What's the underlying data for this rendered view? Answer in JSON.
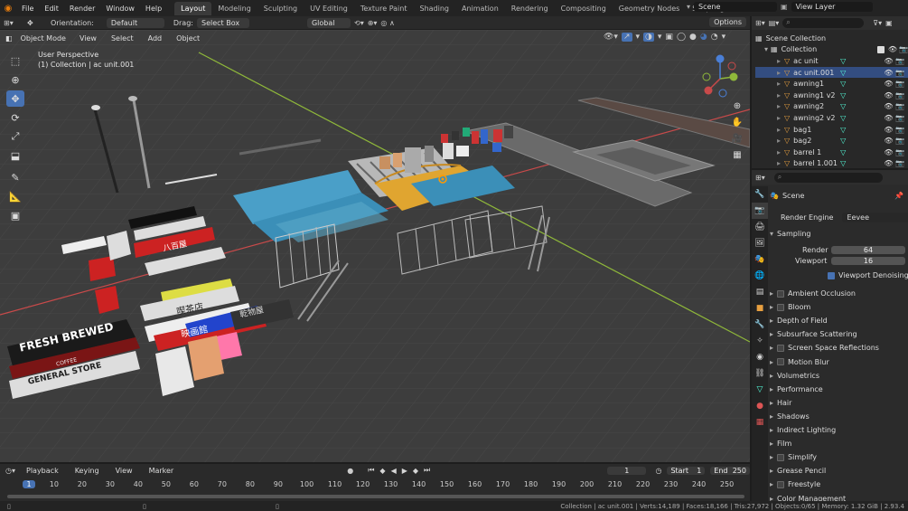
{
  "menubar": {
    "items": [
      "File",
      "Edit",
      "Render",
      "Window",
      "Help"
    ],
    "workspaces": [
      "Layout",
      "Modeling",
      "Sculpting",
      "UV Editing",
      "Texture Paint",
      "Shading",
      "Animation",
      "Rendering",
      "Compositing",
      "Geometry Nodes",
      "Scripting"
    ],
    "active_workspace": "Layout",
    "scene": "Scene",
    "view_layer": "View Layer"
  },
  "tool_header": {
    "orientation_label": "Orientation:",
    "orientation_value": "Default",
    "drag_label": "Drag:",
    "drag_value": "Select Box",
    "transform_value": "Global",
    "options": "Options"
  },
  "viewport_header": {
    "mode": "Object Mode",
    "menus": [
      "View",
      "Select",
      "Add",
      "Object"
    ]
  },
  "viewport": {
    "perspective": "User Perspective",
    "collection_info": "(1) Collection | ac unit.001",
    "signs": [
      "FRESH BREWED",
      "COFFEE",
      "GENERAL STORE",
      "八百屋",
      "喫茶店",
      "映画館",
      "乾物屋"
    ]
  },
  "outliner": {
    "root": "Scene Collection",
    "collection": "Collection",
    "items": [
      "ac unit",
      "ac unit.001",
      "awning1",
      "awning1 v2",
      "awning2",
      "awning2 v2",
      "bag1",
      "bag2",
      "barrel 1",
      "barrel 1.001"
    ]
  },
  "properties": {
    "title": "Scene",
    "render_engine_label": "Render Engine",
    "render_engine_value": "Eevee",
    "sampling": "Sampling",
    "render_label": "Render",
    "render_value": "64",
    "viewport_label": "Viewport",
    "viewport_value": "16",
    "denoising": "Viewport Denoising",
    "sections": [
      "Ambient Occlusion",
      "Bloom",
      "Depth of Field",
      "Subsurface Scattering",
      "Screen Space Reflections",
      "Motion Blur",
      "Volumetrics",
      "Performance",
      "Hair",
      "Shadows",
      "Indirect Lighting",
      "Film",
      "Simplify",
      "Grease Pencil",
      "Freestyle",
      "Color Management"
    ],
    "checkbox_sections": [
      "Ambient Occlusion",
      "Bloom",
      "Screen Space Reflections",
      "Motion Blur",
      "Simplify",
      "Freestyle"
    ]
  },
  "timeline": {
    "menus": [
      "Playback",
      "Keying",
      "View",
      "Marker"
    ],
    "current_frame": "1",
    "start_label": "Start",
    "start_value": "1",
    "end_label": "End",
    "end_value": "250",
    "ruler": [
      "1",
      "10",
      "20",
      "30",
      "40",
      "50",
      "60",
      "70",
      "80",
      "90",
      "100",
      "110",
      "120",
      "130",
      "140",
      "150",
      "160",
      "170",
      "180",
      "190",
      "200",
      "210",
      "220",
      "230",
      "240",
      "250"
    ]
  },
  "statusbar": {
    "text": "Collection | ac unit.001 | Verts:14,189 | Faces:18,166 | Tris:27,972 | Objects:0/65 | Memory: 1.32 GiB | 2.93.4"
  },
  "colors": {
    "accent": "#4772b3",
    "x_axis": "#c84a4a",
    "y_axis": "#8fb83a",
    "z_axis": "#4a7fd6"
  }
}
